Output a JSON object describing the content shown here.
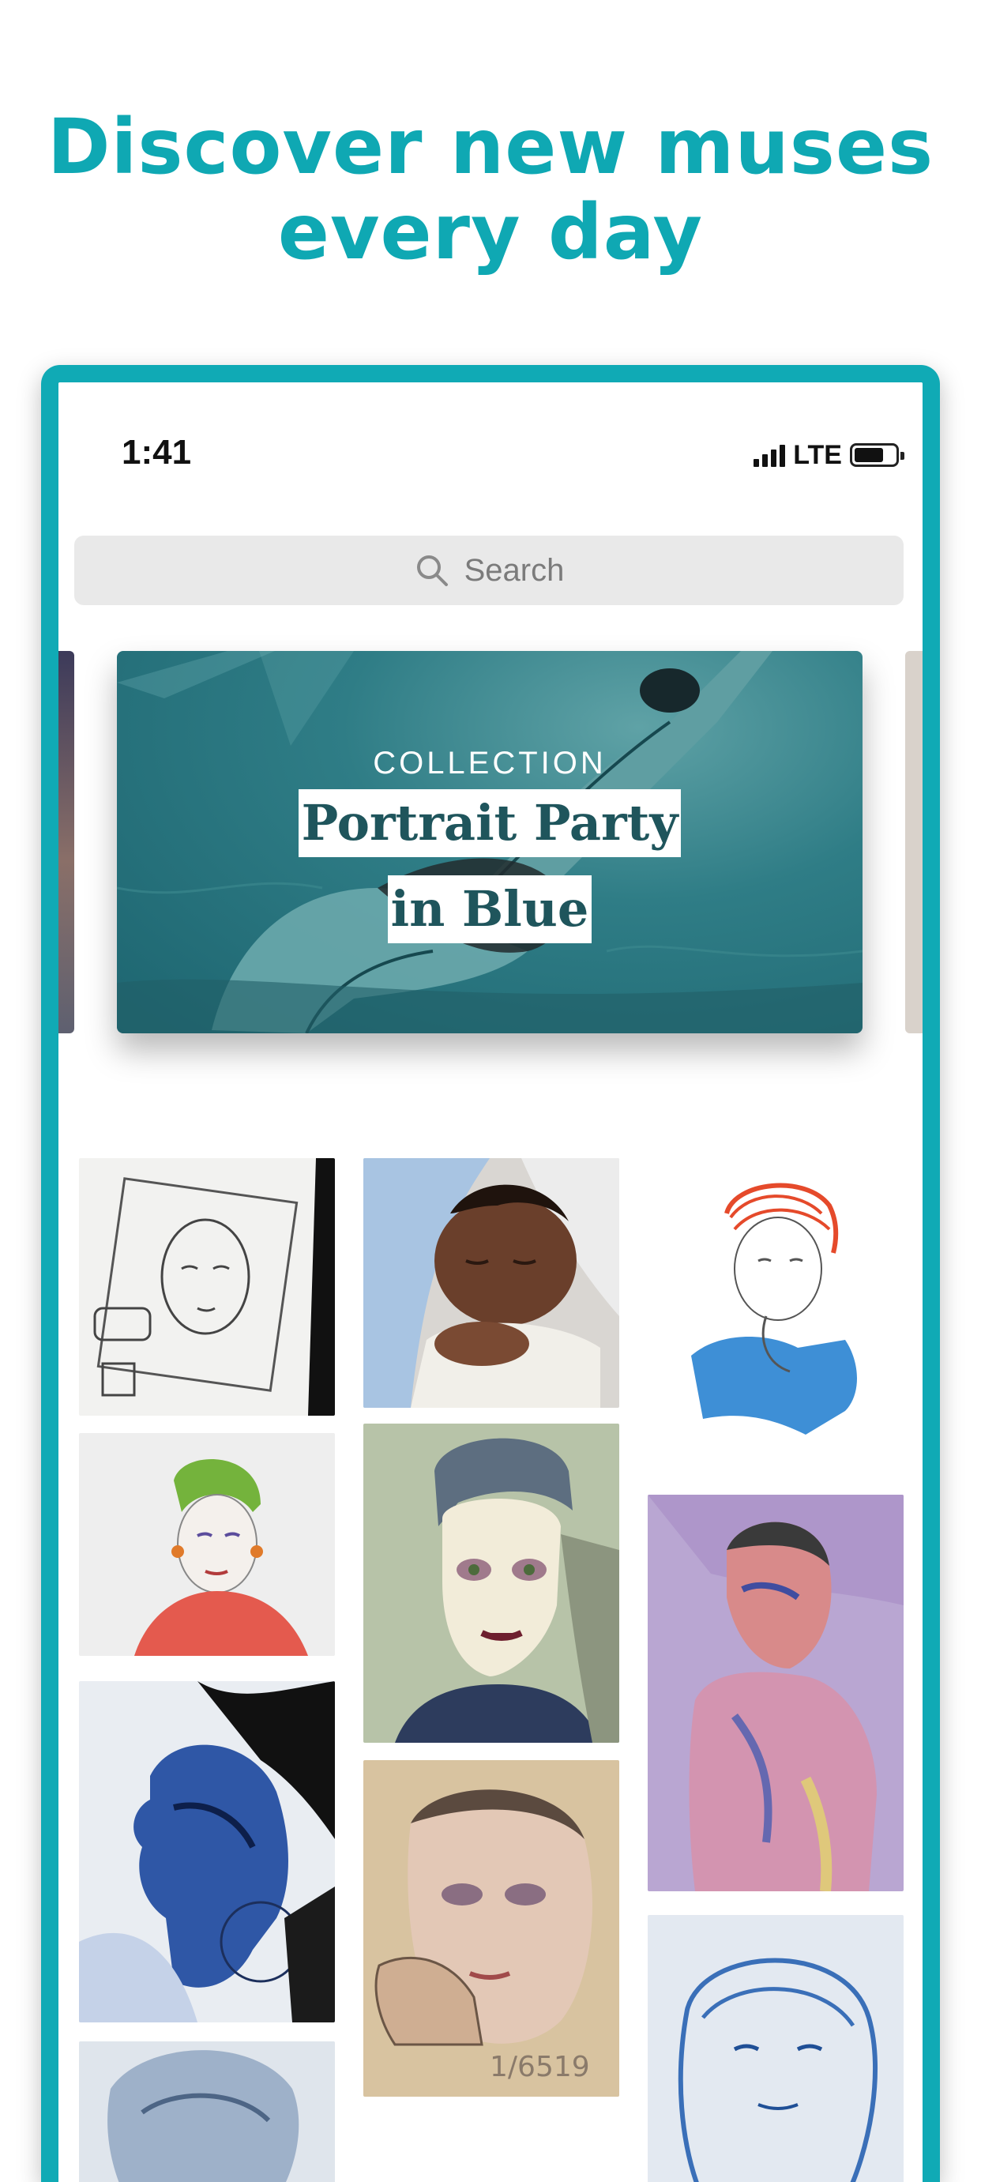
{
  "headline": {
    "line1": "Discover new muses",
    "line2": "every day"
  },
  "status_bar": {
    "time": "1:41",
    "network": "LTE"
  },
  "search": {
    "placeholder": "Search"
  },
  "featured_collection": {
    "kicker": "COLLECTION",
    "title_line1": "Portrait Party",
    "title_line2": "in Blue"
  },
  "artworks": [
    {
      "name": "sketch-comic-portrait"
    },
    {
      "name": "sleeping-baby-painting"
    },
    {
      "name": "red-hair-line-drawing"
    },
    {
      "name": "green-hair-woman-pencil"
    },
    {
      "name": "short-hair-painted-portrait"
    },
    {
      "name": "watercolor-purple-figure"
    },
    {
      "name": "blue-profile-painting"
    },
    {
      "name": "hand-on-face-portrait",
      "caption": "1/6519"
    },
    {
      "name": "blue-woman-face"
    },
    {
      "name": "partial-portrait"
    }
  ],
  "colors": {
    "accent": "#10aab5",
    "card_text": "#1f555c"
  }
}
